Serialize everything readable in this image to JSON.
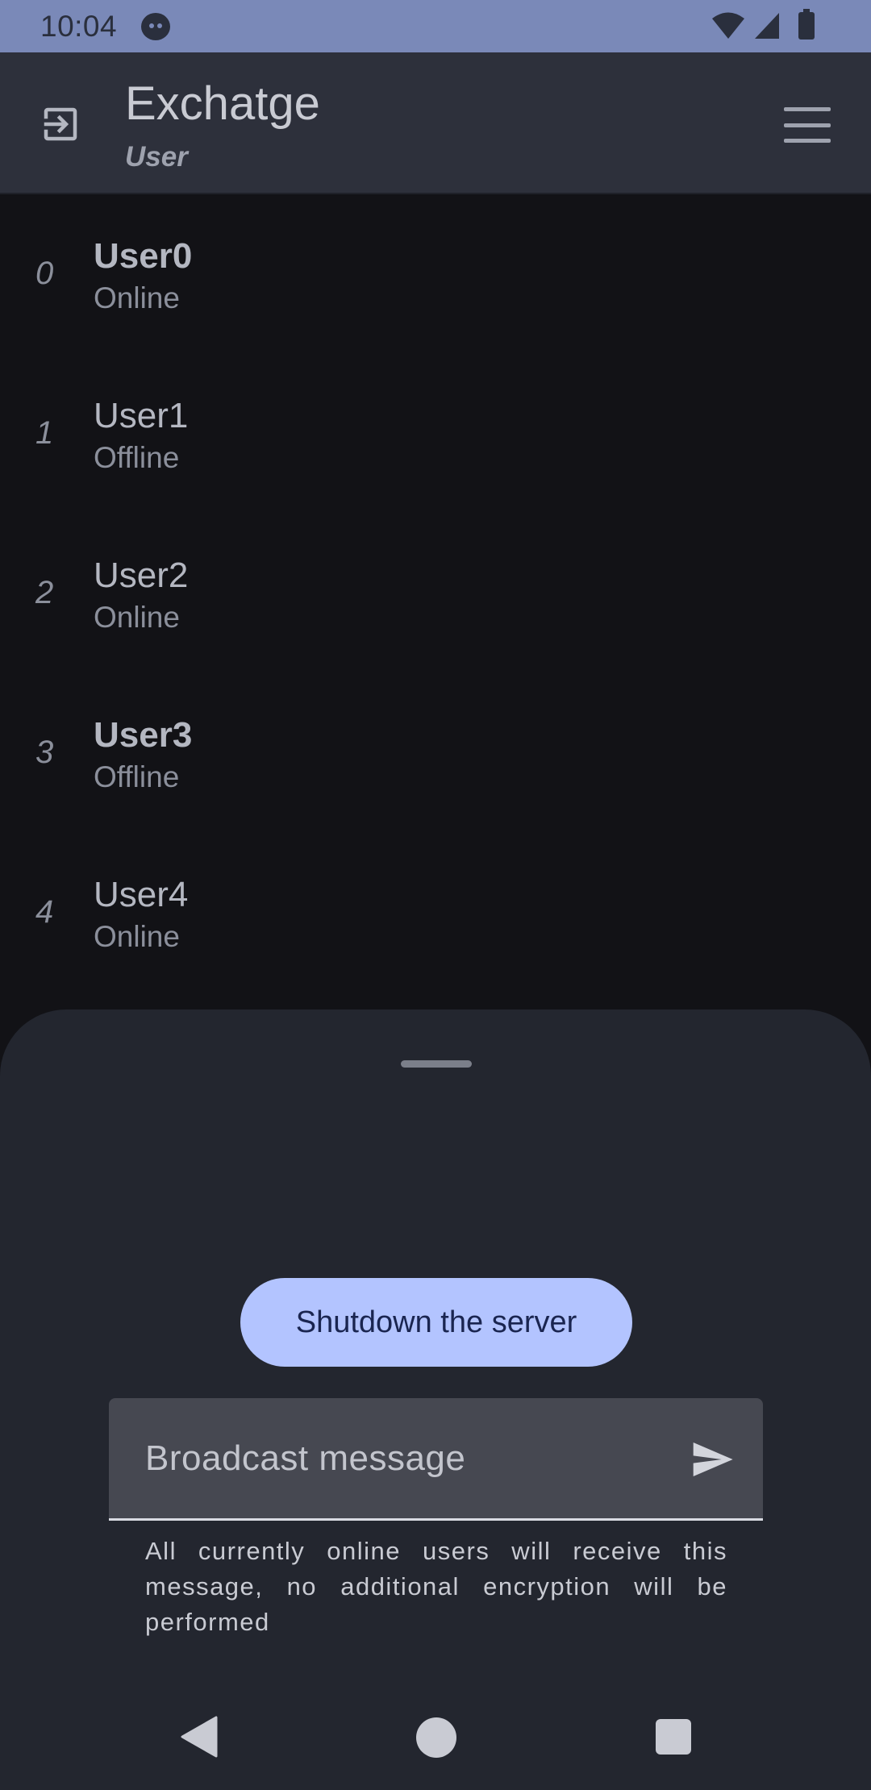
{
  "status_bar": {
    "time": "10:04"
  },
  "app_bar": {
    "title": "Exchatge",
    "subtitle": "User"
  },
  "users": [
    {
      "index": "0",
      "name": "User0",
      "status": "Online",
      "bold": true
    },
    {
      "index": "1",
      "name": "User1",
      "status": "Offline",
      "bold": false
    },
    {
      "index": "2",
      "name": "User2",
      "status": "Online",
      "bold": false
    },
    {
      "index": "3",
      "name": "User3",
      "status": "Offline",
      "bold": true
    },
    {
      "index": "4",
      "name": "User4",
      "status": "Online",
      "bold": false
    }
  ],
  "sheet": {
    "shutdown_label": "Shutdown the server",
    "broadcast_placeholder": "Broadcast message",
    "helper_text": "All currently online users will receive this message, no additional encryption will be performed"
  },
  "icons": {
    "exit": "exit-to-app-icon",
    "menu": "menu-icon",
    "send": "send-icon"
  },
  "colors": {
    "status_bar": "#7a89b8",
    "app_bar": "#2d303b",
    "background": "#121216",
    "sheet": "#23262f",
    "primary_button": "#b3c4ff"
  }
}
